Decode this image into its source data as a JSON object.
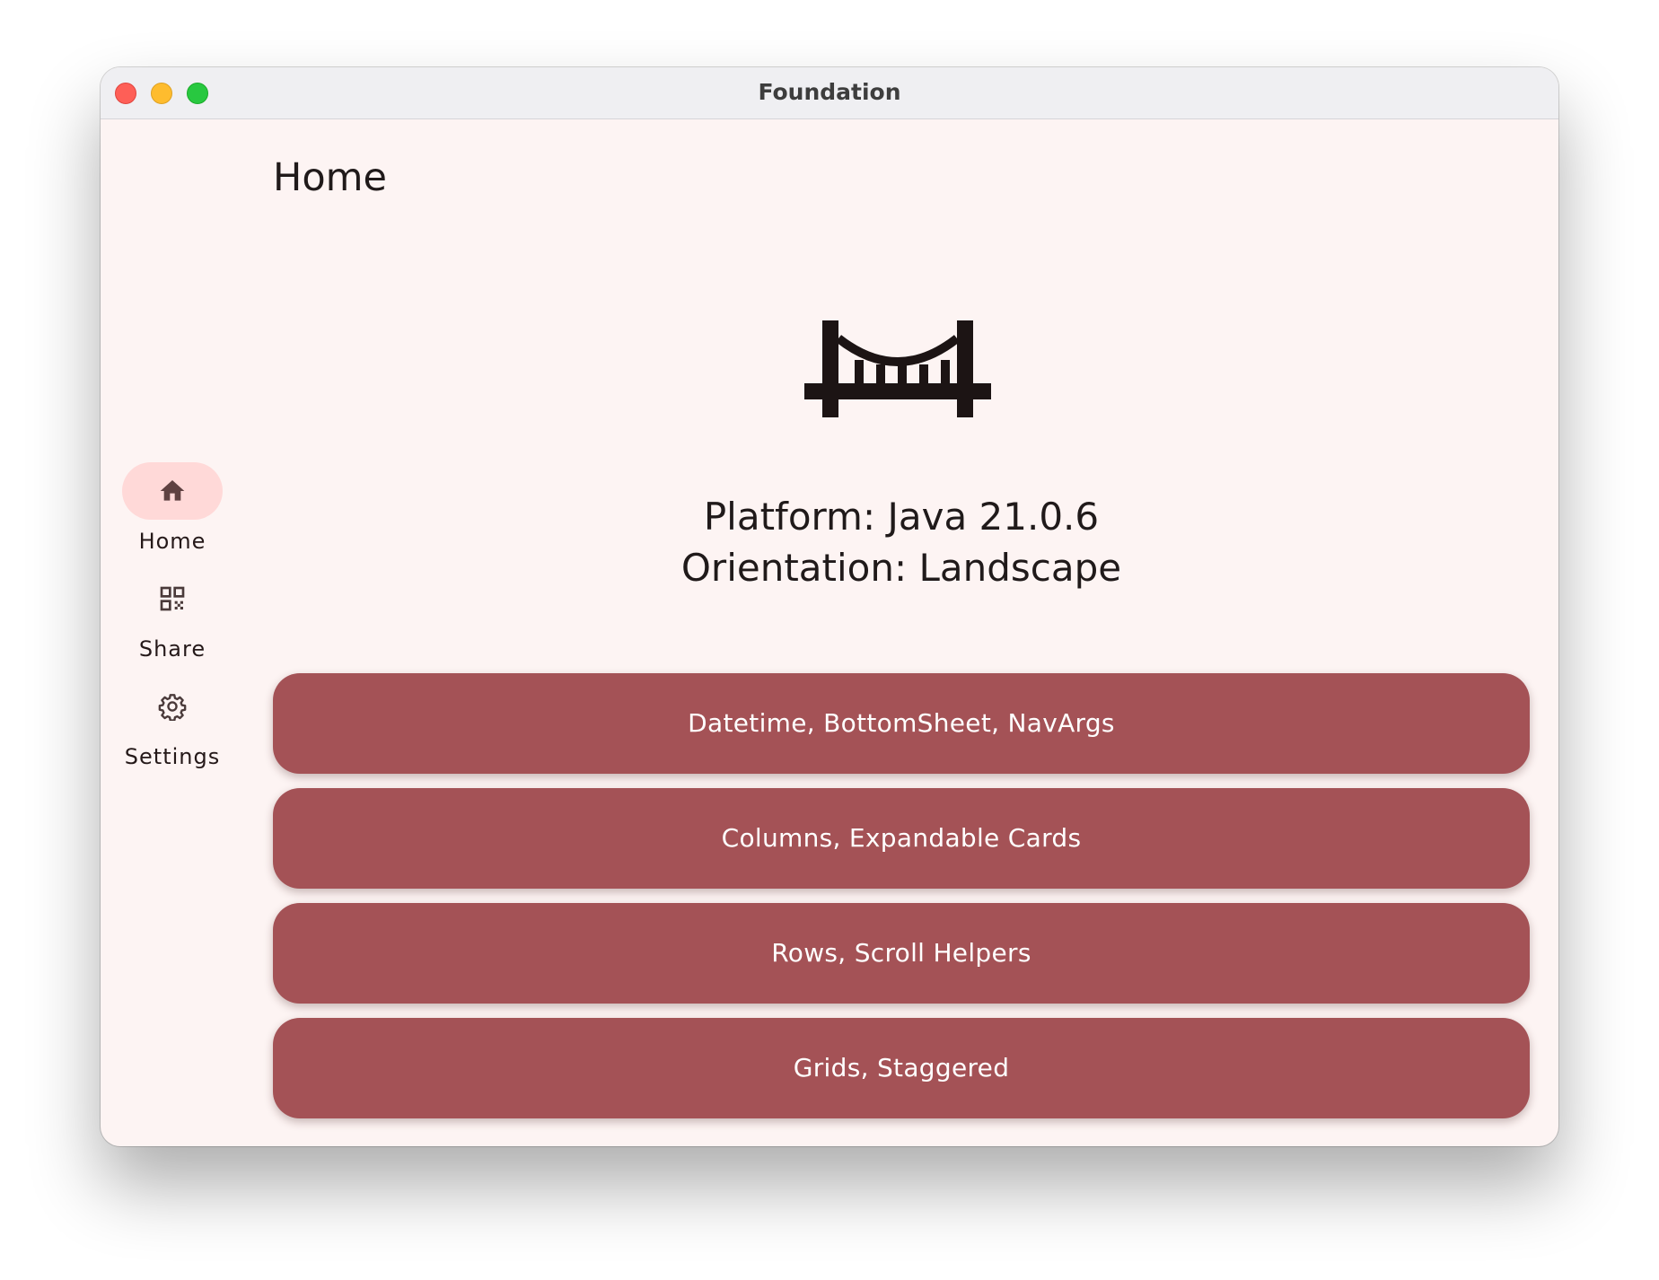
{
  "window": {
    "title": "Foundation",
    "controls": [
      "close",
      "minimize",
      "maximize"
    ]
  },
  "page": {
    "title": "Home"
  },
  "rail": {
    "items": [
      {
        "label": "Home",
        "icon": "home-icon",
        "selected": true
      },
      {
        "label": "Share",
        "icon": "qr-code-icon",
        "selected": false
      },
      {
        "label": "Settings",
        "icon": "gear-icon",
        "selected": false
      }
    ]
  },
  "hero": {
    "icon": "bridge-icon"
  },
  "info": {
    "platform": "Platform: Java 21.0.6",
    "orientation": "Orientation: Landscape"
  },
  "buttons": [
    {
      "label": "Datetime, BottomSheet, NavArgs"
    },
    {
      "label": "Columns, Expandable Cards"
    },
    {
      "label": "Rows, Scroll Helpers"
    },
    {
      "label": "Grids, Staggered"
    }
  ],
  "colors": {
    "background": "#fdf4f3",
    "button": "#a45256",
    "button_text": "#ffffff",
    "rail_indicator": "#ffd9d8",
    "icon": "#5f4141",
    "text": "#201a1a"
  }
}
